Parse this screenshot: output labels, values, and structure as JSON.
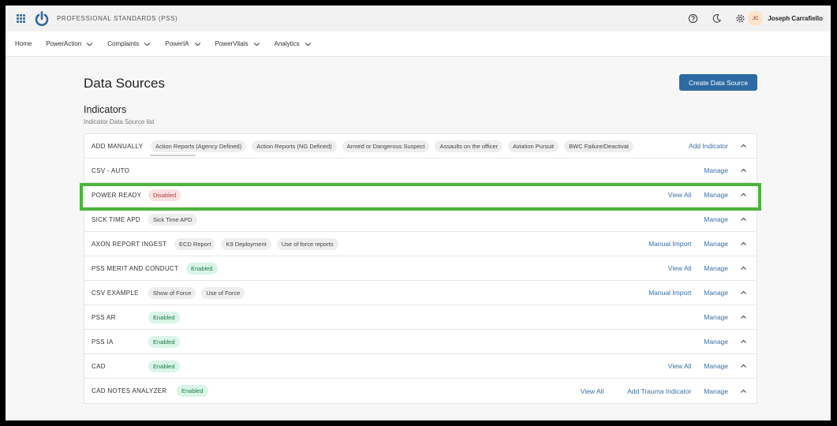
{
  "header": {
    "brand": "PROFESSIONAL STANDARDS (PSS)",
    "user_initials": "JC",
    "user_name": "Joseph Carrafiello",
    "icons": [
      "apps-grid-icon",
      "power-logo-icon",
      "help-icon",
      "moon-icon",
      "gear-icon"
    ]
  },
  "nav": {
    "items": [
      "Home",
      "PowerAction",
      "Complaints",
      "PowerIA",
      "PowerVitals",
      "Analytics"
    ]
  },
  "page": {
    "title": "Data Sources",
    "create_label": "Create Data Source",
    "section_title": "Indicators",
    "section_subtitle": "Indicator Data Source list"
  },
  "colors": {
    "accent": "#2d6aa3",
    "link": "#3a70a8",
    "highlight": "#4db33d",
    "enabled_bg": "#d8f5e7",
    "disabled_bg": "#fbe1e1"
  },
  "sources": [
    {
      "name": "ADD MANUALLY",
      "chips": [
        "Action Reports (Agency Defined)",
        "Action Reports (NG Defined)",
        "Armed or Dangerous Suspect",
        "Assaults on the officer",
        "Aviation Pursuit",
        "BWC Failure/Deactivat"
      ],
      "actions": [
        "Add Indicator"
      ]
    },
    {
      "name": "CSV - AUTO",
      "actions": [
        "Manage"
      ]
    },
    {
      "name": "POWER READY",
      "status": "Disabled",
      "actions": [
        "View All",
        "Manage"
      ]
    },
    {
      "name": "SICK TIME APD",
      "chips": [
        "Sick Time APD"
      ],
      "actions": [
        "Manage"
      ]
    },
    {
      "name": "AXON REPORT INGEST",
      "chips": [
        "ECD Report",
        "K9 Deployment",
        "Use of force reports"
      ],
      "actions": [
        "Manual Import",
        "Manage"
      ]
    },
    {
      "name": "PSS MERIT AND CONDUCT",
      "status": "Enabled",
      "actions": [
        "View All",
        "Manage"
      ]
    },
    {
      "name": "CSV EXAMPLE",
      "chips": [
        "Show of Force",
        "Use of Force"
      ],
      "actions": [
        "Manual Import",
        "Manage"
      ]
    },
    {
      "name": "PSS AR",
      "status": "Enabled",
      "actions": [
        "Manage"
      ]
    },
    {
      "name": "PSS IA",
      "status": "Enabled",
      "actions": [
        "Manage"
      ]
    },
    {
      "name": "CAD",
      "status": "Enabled",
      "actions": [
        "View All",
        "Manage"
      ]
    },
    {
      "name": "CAD NOTES ANALYZER",
      "status": "Enabled",
      "actions": [
        "View All",
        "Add Trauma Indicator",
        "Manage"
      ]
    }
  ]
}
